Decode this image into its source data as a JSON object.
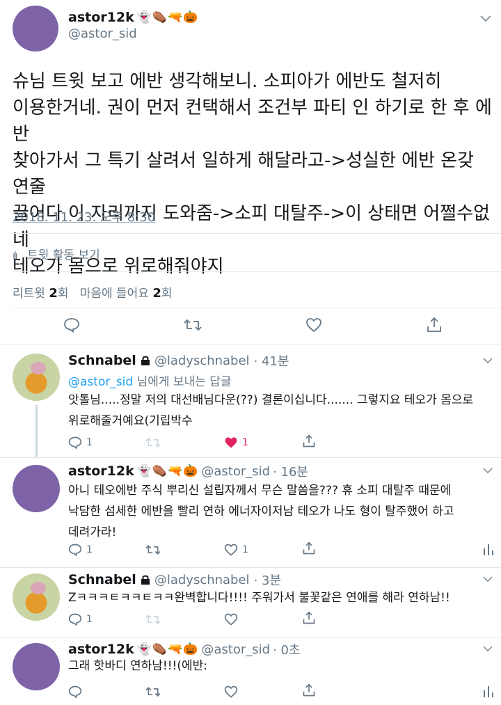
{
  "main_tweet": {
    "author_name": "astor12k",
    "author_emoji": "👻⚰️🔫🎃",
    "author_handle": "@astor_sid",
    "text": "슈님 트윗 보고 에반 생각해보니. 소피아가 에반도 철저히\n이용한거네. 권이 먼저 컨택해서 조건부 파티 인 하기로 한 후 에반\n찾아가서 그 특기 살려서 일하게 해달라고->성실한 에반 온갖 연줄\n끌어다 이 자리까지 도와줌->소피 대탈주->이 상태면 어쩔수없네\n테오가 몸으로 위로해줘야지",
    "timestamp": "2018. 11. 23. 오후 8:30",
    "activity_label": "트윗 활동 보기",
    "retweet_label": "리트윗",
    "retweet_count": "2",
    "retweet_unit": "회",
    "like_label": "마음에 들어요",
    "like_count": "2",
    "like_unit": "회"
  },
  "replies": [
    {
      "author_name": "Schnabel",
      "author_handle": "@ladyschnabel",
      "time": "· 41분",
      "reply_to_handle": "@astor_sid",
      "reply_to_suffix": " 님에게 보내는 답글",
      "text_line1": "앗톨님.....정말 저의 대선배님다운(??) 결론이십니다....... 그렇지요 테오가 몸으로",
      "text_line2": "위로해줄거예요(기립박수",
      "reply_count": "1",
      "like_count": "1",
      "liked": true
    },
    {
      "author_name": "astor12k",
      "author_emoji": "👻⚰️🔫🎃",
      "author_handle": "@astor_sid",
      "time": "· 16분",
      "text_line1": "아니 테오에반 주식 뿌리신 설립자께서 무슨 말씀을??? 휴 소피 대탈주 때문에",
      "text_line2": "낙담한 섬세한 에반을 빨리 연하 에너자이저남 테오가 나도 형이 탈주했어 하고",
      "text_line3": "데려가라!",
      "reply_count": "1",
      "like_count": "1"
    },
    {
      "author_name": "Schnabel",
      "author_handle": "@ladyschnabel",
      "time": "· 3분",
      "text_line1": "Zㅋㅋㅋㅌㅋㅋㅌㅋㅋ완벽합니다!!!! 주워가서 불꽃같은 연애를 해라 연하남!!",
      "reply_count": "1"
    },
    {
      "author_name": "astor12k",
      "author_emoji": "👻⚰️🔫🎃",
      "author_handle": "@astor_sid",
      "time": "· 0초",
      "text_line1": "그래 핫바디 연하남!!!(에반:"
    }
  ],
  "colors": {
    "accent": "#1da1f2",
    "like": "#e0245e",
    "muted": "#657786",
    "avatar_purple": "#7e63a8"
  }
}
